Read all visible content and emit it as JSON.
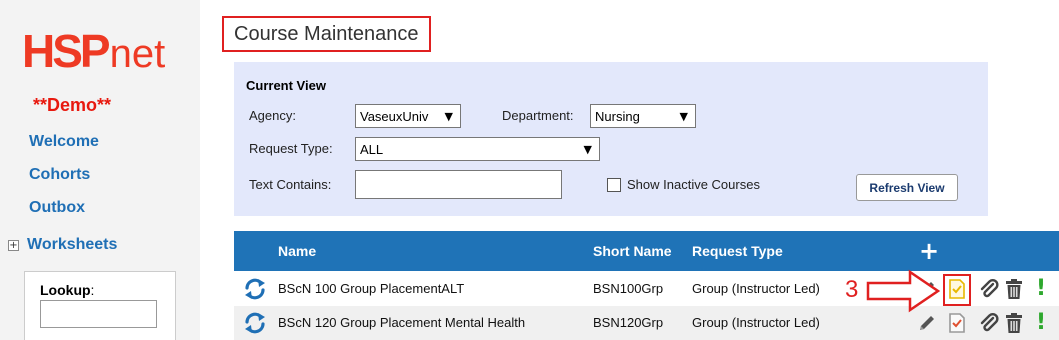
{
  "sidebar": {
    "logo_hsp": "HSP",
    "logo_net": "net",
    "demo_label": "**Demo**",
    "items": [
      {
        "label": "Welcome"
      },
      {
        "label": "Cohorts"
      },
      {
        "label": "Outbox"
      }
    ],
    "worksheets_label": "Worksheets",
    "lookup_label": "Lookup",
    "lookup_suffix": ":"
  },
  "page_title": "Course Maintenance",
  "current_view": {
    "title": "Current View",
    "agency_label": "Agency:",
    "agency_value": "VaseuxUniv",
    "department_label": "Department:",
    "department_value": "Nursing",
    "request_type_label": "Request Type:",
    "request_type_value": "ALL",
    "text_contains_label": "Text Contains:",
    "text_contains_value": "",
    "show_inactive_label": "Show Inactive Courses",
    "refresh_label": "Refresh View"
  },
  "table": {
    "headers": {
      "name": "Name",
      "short_name": "Short Name",
      "request_type": "Request Type",
      "add": "+"
    },
    "rows": [
      {
        "name": "BScN 100 Group PlacementALT",
        "short_name": "BSN100Grp",
        "request_type": "Group (Instructor Led)"
      },
      {
        "name": "BScN 120 Group Placement Mental Health",
        "short_name": "BSN120Grp",
        "request_type": "Group (Instructor Led)"
      }
    ]
  },
  "annotation": {
    "step_number": "3"
  },
  "colors": {
    "brand_red": "#ee3a24",
    "link_blue": "#1f6fb5",
    "header_blue": "#1f73b7",
    "panel_bg": "#e3e8fb",
    "annotation_red": "#e02020",
    "status_green": "#2ea82e"
  },
  "icons": {
    "sync": "sync-icon",
    "edit": "pencil-icon",
    "approve": "document-check-icon",
    "attach": "paperclip-icon",
    "delete": "trash-icon",
    "status": "exclamation-icon",
    "add": "plus-icon",
    "expand": "plus-square-icon"
  }
}
